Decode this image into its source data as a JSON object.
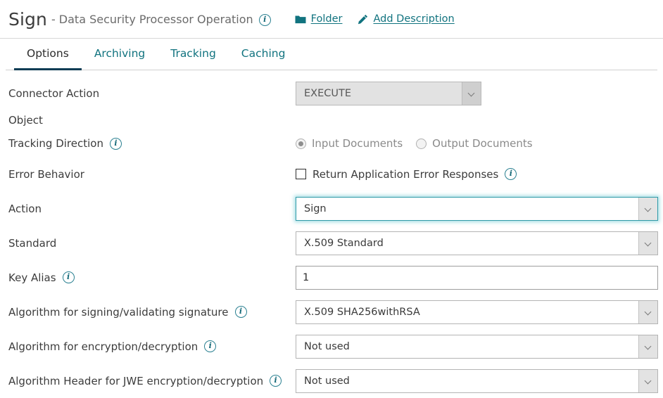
{
  "header": {
    "title": "Sign",
    "subtitle": "- Data Security Processor Operation",
    "info_icon": "info-icon",
    "links": [
      {
        "label": "Folder",
        "icon": "folder-icon"
      },
      {
        "label": "Add Description",
        "icon": "pencil-icon"
      }
    ]
  },
  "tabs": [
    {
      "label": "Options",
      "active": true
    },
    {
      "label": "Archiving",
      "active": false
    },
    {
      "label": "Tracking",
      "active": false
    },
    {
      "label": "Caching",
      "active": false
    }
  ],
  "form": {
    "connector_action": {
      "label": "Connector Action",
      "value": "EXECUTE",
      "disabled": true
    },
    "object": {
      "label": "Object"
    },
    "tracking_direction": {
      "label": "Tracking Direction",
      "info_icon": "info-icon",
      "options": [
        {
          "label": "Input Documents",
          "selected": true
        },
        {
          "label": "Output Documents",
          "selected": false
        }
      ]
    },
    "error_behavior": {
      "label": "Error Behavior",
      "checkbox_label": "Return Application Error Responses",
      "checked": false,
      "info_icon": "info-icon"
    },
    "action": {
      "label": "Action",
      "value": "Sign",
      "focused": true
    },
    "standard": {
      "label": "Standard",
      "value": "X.509 Standard"
    },
    "key_alias": {
      "label": "Key Alias",
      "value": "1",
      "placeholder": "",
      "info_icon": "info-icon"
    },
    "algorithm_signing": {
      "label": "Algorithm for signing/validating signature",
      "value": "X.509 SHA256withRSA",
      "info_icon": "info-icon"
    },
    "algorithm_encryption": {
      "label": "Algorithm for encryption/decryption",
      "value": "Not used",
      "info_icon": "info-icon"
    },
    "algorithm_jwe_header": {
      "label": "Algorithm Header for JWE encryption/decryption",
      "value": "Not used",
      "info_icon": "info-icon"
    }
  },
  "colors": {
    "accent_teal": "#11737f",
    "tab_underline": "#0b3c54",
    "focus_ring": "#2f9aa8",
    "text_primary": "#3c3c3c",
    "text_muted": "#8a8a8a"
  }
}
